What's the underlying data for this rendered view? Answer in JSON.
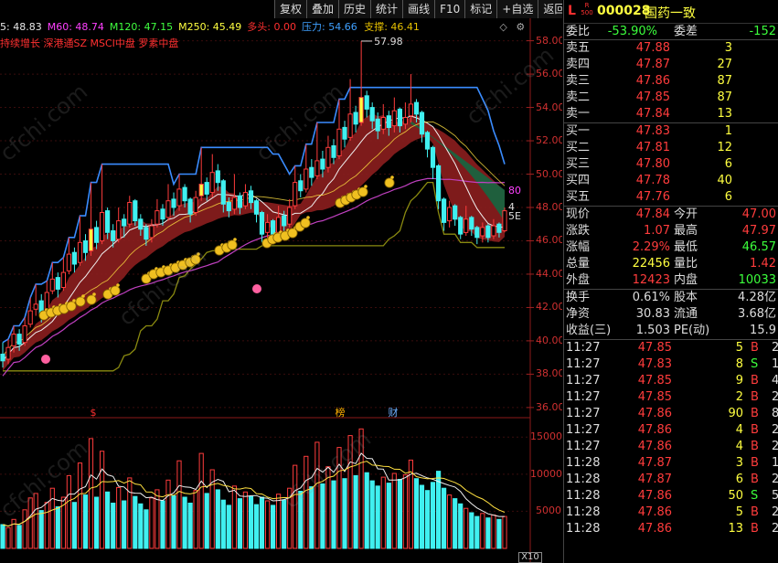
{
  "toolbar": [
    "复权",
    "叠加",
    "历史",
    "统计",
    "画线",
    "F10",
    "标记",
    "+自选",
    "返回"
  ],
  "ma": [
    {
      "label": "5: 48.83",
      "color": "#e8e8e8"
    },
    {
      "label": "M60: 48.74",
      "color": "#ff40ff"
    },
    {
      "label": "M120: 47.15",
      "color": "#40ff40"
    },
    {
      "label": "M250: 45.49",
      "color": "#ffff40"
    },
    {
      "label": "多头: 0.00",
      "color": "#ff3030"
    }
  ],
  "pressure_label": "压力: 54.66",
  "support_label": "支撑: 46.41",
  "concepts": "持续增长 深港通SZ MSCI中盘 罗素中盘",
  "price_high_label": "57.98",
  "price_axis": [
    "58.00",
    "56.00",
    "54.00",
    "52.00",
    "50.00",
    "48.00",
    "46.00",
    "44.00",
    "42.00",
    "40.00",
    "38.00",
    "36.00"
  ],
  "vol_axis": [
    "15000",
    "10000",
    "5000"
  ],
  "vol_unit": "X10",
  "markers": [
    {
      "text": "$",
      "color": "#ff3030"
    },
    {
      "text": "榜",
      "color": "#ffb000"
    },
    {
      "text": "财",
      "color": "#6fb0ff"
    }
  ],
  "right_edge_labels": [
    "80",
    "4",
    "5E"
  ],
  "watermark": "cfchi.com",
  "stock": {
    "prefix": "L",
    "sub": "R 500",
    "code": "000028",
    "name": "国药一致"
  },
  "weibi": {
    "label1": "委比",
    "value1": "-53.90%",
    "label2": "委差",
    "value2": "-152"
  },
  "asks": [
    {
      "label": "卖五",
      "price": "47.88",
      "vol": "3"
    },
    {
      "label": "卖四",
      "price": "47.87",
      "vol": "27"
    },
    {
      "label": "卖三",
      "price": "47.86",
      "vol": "87"
    },
    {
      "label": "卖二",
      "price": "47.85",
      "vol": "87"
    },
    {
      "label": "卖一",
      "price": "47.84",
      "vol": "13"
    }
  ],
  "bids": [
    {
      "label": "买一",
      "price": "47.83",
      "vol": "1"
    },
    {
      "label": "买二",
      "price": "47.81",
      "vol": "12"
    },
    {
      "label": "买三",
      "price": "47.80",
      "vol": "6"
    },
    {
      "label": "买四",
      "price": "47.78",
      "vol": "40"
    },
    {
      "label": "买五",
      "price": "47.76",
      "vol": "6"
    }
  ],
  "stats1": [
    {
      "l1": "现价",
      "v1": "47.84",
      "c1": "red",
      "l2": "今开",
      "v2": "47.00",
      "c2": "red"
    },
    {
      "l1": "涨跌",
      "v1": "1.07",
      "c1": "red",
      "l2": "最高",
      "v2": "47.97",
      "c2": "red"
    },
    {
      "l1": "涨幅",
      "v1": "2.29%",
      "c1": "red",
      "l2": "最低",
      "v2": "46.57",
      "c2": "green"
    },
    {
      "l1": "总量",
      "v1": "22456",
      "c1": "yel",
      "l2": "量比",
      "v2": "1.42",
      "c2": "red"
    },
    {
      "l1": "外盘",
      "v1": "12423",
      "c1": "red",
      "l2": "内盘",
      "v2": "10033",
      "c2": "green"
    }
  ],
  "stats2": [
    {
      "l1": "换手",
      "v1": "0.61%",
      "c1": "wht",
      "l2": "股本",
      "v2": "4.28亿",
      "c2": "wht"
    },
    {
      "l1": "净资",
      "v1": "30.83",
      "c1": "wht",
      "l2": "流通",
      "v2": "3.68亿",
      "c2": "wht"
    },
    {
      "l1": "收益(三)",
      "v1": "1.503",
      "c1": "wht",
      "l2": "PE(动)",
      "v2": "15.9",
      "c2": "wht"
    }
  ],
  "ticks": [
    {
      "time": "11:27",
      "price": "47.85",
      "pc": "red",
      "vol": "5",
      "side": "B",
      "sc": "red",
      "n": "2"
    },
    {
      "time": "11:27",
      "price": "47.83",
      "pc": "red",
      "vol": "8",
      "side": "S",
      "sc": "green",
      "n": "1"
    },
    {
      "time": "11:27",
      "price": "47.85",
      "pc": "red",
      "vol": "9",
      "side": "B",
      "sc": "red",
      "n": "4"
    },
    {
      "time": "11:27",
      "price": "47.85",
      "pc": "red",
      "vol": "2",
      "side": "B",
      "sc": "red",
      "n": "2"
    },
    {
      "time": "11:27",
      "price": "47.86",
      "pc": "red",
      "vol": "90",
      "side": "B",
      "sc": "red",
      "n": "8"
    },
    {
      "time": "11:27",
      "price": "47.86",
      "pc": "red",
      "vol": "4",
      "side": "B",
      "sc": "red",
      "n": "2"
    },
    {
      "time": "11:27",
      "price": "47.86",
      "pc": "red",
      "vol": "4",
      "side": "B",
      "sc": "red",
      "n": "2"
    },
    {
      "time": "11:28",
      "price": "47.87",
      "pc": "red",
      "vol": "3",
      "side": "B",
      "sc": "red",
      "n": "1"
    },
    {
      "time": "11:28",
      "price": "47.87",
      "pc": "red",
      "vol": "6",
      "side": "B",
      "sc": "red",
      "n": "2"
    },
    {
      "time": "11:28",
      "price": "47.86",
      "pc": "red",
      "vol": "50",
      "side": "S",
      "sc": "green",
      "n": "5"
    },
    {
      "time": "11:28",
      "price": "47.86",
      "pc": "red",
      "vol": "5",
      "side": "B",
      "sc": "red",
      "n": "2"
    },
    {
      "time": "11:28",
      "price": "47.86",
      "pc": "red",
      "vol": "13",
      "side": "B",
      "sc": "red",
      "n": "2"
    }
  ],
  "chart_data": {
    "type": "candlestick",
    "price_range": [
      35.5,
      58.8
    ],
    "high_annotation": 57.98,
    "candles": [
      [
        39.2,
        38.8,
        39.9,
        38.4
      ],
      [
        38.9,
        39.6,
        40.1,
        38.6
      ],
      [
        39.7,
        40.4,
        40.9,
        39.3
      ],
      [
        40.4,
        39.8,
        40.7,
        39.4
      ],
      [
        39.9,
        40.9,
        41.4,
        39.7
      ],
      [
        41.0,
        41.8,
        42.6,
        40.8
      ],
      [
        41.9,
        42.2,
        43.4,
        41.5
      ],
      [
        42.4,
        41.6,
        42.8,
        41.1
      ],
      [
        41.7,
        42.9,
        43.6,
        41.5
      ],
      [
        43.0,
        43.7,
        44.7,
        42.8
      ],
      [
        43.8,
        43.1,
        44.1,
        42.6
      ],
      [
        43.2,
        44.1,
        45.0,
        43.0
      ],
      [
        44.2,
        45.2,
        46.2,
        44.0
      ],
      [
        45.3,
        44.6,
        45.6,
        44.1
      ],
      [
        44.7,
        45.9,
        47.5,
        44.5
      ],
      [
        46.0,
        45.3,
        46.4,
        44.8
      ],
      [
        45.4,
        46.7,
        49.5,
        45.1
      ],
      [
        46.8,
        45.9,
        47.2,
        45.5
      ],
      [
        46.0,
        47.7,
        50.6,
        45.8
      ],
      [
        47.8,
        46.5,
        48.0,
        46.1
      ],
      [
        46.6,
        46.0,
        47.0,
        45.6
      ],
      [
        46.1,
        47.2,
        48.0,
        45.9
      ],
      [
        47.3,
        46.9,
        47.6,
        46.2
      ],
      [
        47.0,
        48.3,
        48.7,
        46.8
      ],
      [
        48.4,
        47.2,
        48.5,
        46.9
      ],
      [
        47.3,
        46.7,
        47.6,
        46.3
      ],
      [
        46.8,
        46.1,
        47.0,
        45.7
      ],
      [
        46.2,
        46.9,
        47.3,
        45.9
      ],
      [
        47.0,
        47.8,
        48.5,
        46.8
      ],
      [
        47.9,
        47.3,
        48.2,
        46.9
      ],
      [
        47.4,
        48.4,
        49.4,
        47.2
      ],
      [
        48.5,
        48.0,
        48.9,
        47.5
      ],
      [
        48.1,
        49.1,
        50.0,
        47.8
      ],
      [
        49.2,
        48.4,
        49.4,
        48.0
      ],
      [
        48.5,
        47.6,
        48.6,
        47.1
      ],
      [
        47.7,
        48.6,
        49.0,
        47.5
      ],
      [
        48.7,
        49.4,
        51.6,
        48.4
      ],
      [
        49.5,
        48.8,
        49.8,
        48.4
      ],
      [
        48.9,
        50.1,
        51.2,
        48.6
      ],
      [
        50.2,
        49.5,
        50.6,
        49.0
      ],
      [
        49.6,
        48.2,
        49.7,
        47.7
      ],
      [
        48.3,
        47.8,
        48.6,
        47.4
      ],
      [
        47.9,
        48.6,
        50.0,
        47.6
      ],
      [
        48.7,
        48.0,
        48.9,
        47.6
      ],
      [
        48.1,
        48.9,
        49.4,
        47.9
      ],
      [
        49.0,
        48.3,
        49.3,
        47.9
      ],
      [
        48.4,
        47.6,
        48.5,
        47.1
      ],
      [
        47.7,
        46.4,
        47.8,
        45.9
      ],
      [
        46.5,
        47.1,
        47.6,
        46.1
      ],
      [
        47.2,
        46.4,
        47.3,
        45.9
      ],
      [
        46.5,
        47.4,
        48.1,
        46.3
      ],
      [
        47.5,
        46.9,
        47.8,
        46.5
      ],
      [
        47.0,
        48.0,
        48.5,
        46.8
      ],
      [
        48.1,
        49.5,
        50.5,
        47.9
      ],
      [
        49.6,
        49.0,
        50.0,
        48.6
      ],
      [
        49.1,
        50.3,
        51.8,
        48.9
      ],
      [
        50.4,
        49.8,
        50.9,
        49.3
      ],
      [
        49.9,
        50.8,
        53.1,
        49.7
      ],
      [
        50.9,
        50.3,
        51.4,
        49.8
      ],
      [
        50.4,
        51.6,
        52.3,
        50.1
      ],
      [
        51.7,
        51.0,
        52.1,
        50.6
      ],
      [
        51.1,
        52.7,
        54.5,
        50.9
      ],
      [
        52.8,
        52.1,
        53.2,
        51.6
      ],
      [
        52.2,
        53.6,
        55.7,
        52.0
      ],
      [
        53.7,
        53.0,
        54.1,
        52.5
      ],
      [
        53.1,
        54.6,
        57.98,
        52.9
      ],
      [
        54.7,
        53.9,
        55.0,
        53.4
      ],
      [
        54.0,
        53.2,
        54.3,
        52.7
      ],
      [
        53.3,
        52.6,
        53.7,
        52.1
      ],
      [
        52.7,
        53.4,
        54.2,
        52.4
      ],
      [
        53.5,
        52.8,
        53.8,
        52.3
      ],
      [
        52.9,
        53.8,
        54.6,
        52.5
      ],
      [
        53.9,
        52.9,
        54.0,
        52.5
      ],
      [
        53.0,
        53.4,
        54.3,
        52.7
      ],
      [
        53.5,
        54.2,
        56.0,
        53.1
      ],
      [
        54.3,
        53.6,
        54.5,
        53.1
      ],
      [
        53.7,
        52.4,
        53.8,
        51.9
      ],
      [
        52.5,
        51.5,
        52.6,
        51.0
      ],
      [
        51.6,
        50.4,
        51.7,
        49.7
      ],
      [
        50.5,
        48.4,
        50.6,
        47.9
      ],
      [
        48.5,
        47.1,
        48.6,
        46.6
      ],
      [
        47.2,
        48.0,
        48.4,
        46.8
      ],
      [
        48.1,
        47.3,
        48.2,
        46.9
      ],
      [
        47.4,
        46.4,
        47.5,
        46.1
      ],
      [
        46.5,
        47.3,
        48.1,
        46.3
      ],
      [
        47.4,
        46.7,
        47.5,
        46.3
      ],
      [
        46.8,
        46.2,
        46.9,
        45.8
      ],
      [
        46.3,
        46.8,
        47.1,
        45.9
      ],
      [
        46.9,
        46.2,
        47.0,
        45.9
      ],
      [
        46.3,
        46.9,
        47.3,
        46.1
      ],
      [
        47.0,
        46.5,
        47.1,
        46.2
      ],
      [
        46.6,
        47.8,
        48.0,
        46.5
      ]
    ],
    "volume": [
      3200,
      2800,
      3900,
      3100,
      5200,
      6800,
      7400,
      5100,
      6200,
      8100,
      5600,
      6900,
      9800,
      6200,
      11500,
      7200,
      14800,
      6900,
      13100,
      7600,
      6100,
      8200,
      6400,
      9500,
      7000,
      6000,
      5200,
      6800,
      7900,
      6400,
      9200,
      7100,
      11800,
      6900,
      6100,
      7800,
      12800,
      7400,
      10600,
      7900,
      6500,
      5800,
      8400,
      6700,
      7600,
      7000,
      5900,
      6900,
      6400,
      5800,
      7300,
      6500,
      8100,
      11200,
      7700,
      12400,
      8300,
      14300,
      8700,
      11000,
      9100,
      13600,
      9400,
      15200,
      9800,
      16100,
      10200,
      9100,
      8400,
      9600,
      8800,
      10100,
      9300,
      9900,
      11900,
      9400,
      8500,
      7800,
      8900,
      10400,
      8100,
      7200,
      6700,
      6000,
      5400,
      4800,
      4300,
      4700,
      4100,
      4500,
      3900,
      4300
    ],
    "volume_range": [
      0,
      17000
    ]
  }
}
